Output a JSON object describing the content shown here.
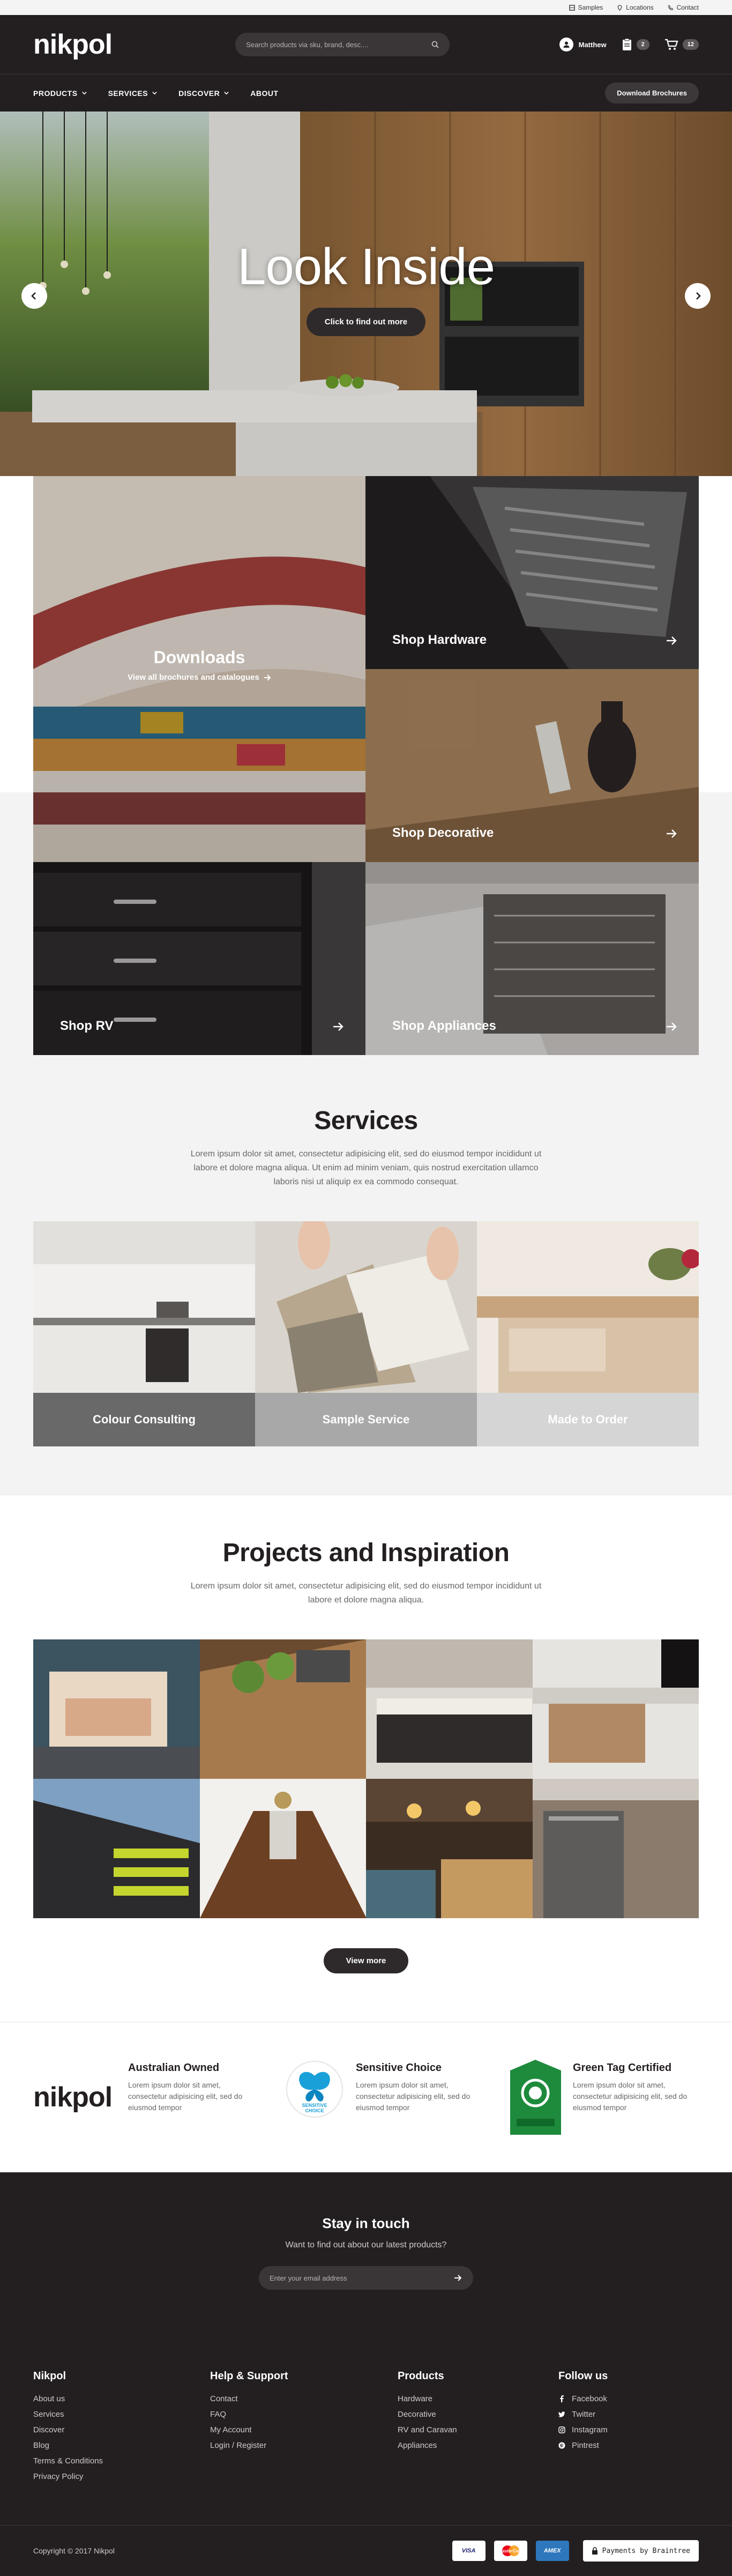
{
  "util_bar": {
    "samples": "Samples",
    "locations": "Locations",
    "contact": "Contact"
  },
  "header": {
    "logo": "nikpol",
    "search_placeholder": "Search products via sku, brand, desc....",
    "user_name": "Matthew",
    "list_count": "2",
    "cart_count": "12"
  },
  "nav": {
    "items": [
      "PRODUCTS",
      "SERVICES",
      "DISCOVER",
      "ABOUT"
    ],
    "download_button": "Download Brochures"
  },
  "hero": {
    "title": "Look Inside",
    "cta": "Click to find out more"
  },
  "categories": {
    "downloads_title": "Downloads",
    "downloads_sub": "View all brochures and catalogues",
    "tiles": [
      "Shop Hardware",
      "Shop Decorative",
      "Shop RV",
      "Shop Appliances"
    ]
  },
  "services": {
    "title": "Services",
    "desc": "Lorem ipsum dolor sit amet, consectetur adipisicing elit, sed do eiusmod tempor incididunt ut labore et dolore magna aliqua. Ut enim ad minim veniam, quis nostrud exercitation ullamco laboris nisi ut aliquip ex ea commodo consequat.",
    "cards": [
      "Colour Consulting",
      "Sample Service",
      "Made to Order"
    ],
    "colors": [
      "#6a6969",
      "#a9a8a8",
      "#d6d5d5"
    ]
  },
  "projects": {
    "title": "Projects and Inspiration",
    "desc": "Lorem ipsum dolor sit amet, consectetur adipisicing elit, sed do eiusmod tempor incididunt ut labore et dolore magna aliqua.",
    "view_more": "View more"
  },
  "trust": {
    "logo": "nikpol",
    "items": [
      {
        "title": "Australian Owned",
        "desc": "Lorem ipsum dolor sit amet, consectetur adipisicing elit, sed do eiusmod tempor"
      },
      {
        "title": "Sensitive Choice",
        "desc": "Lorem ipsum dolor sit amet, consectetur adipisicing elit, sed do eiusmod tempor"
      },
      {
        "title": "Green Tag Certified",
        "desc": "Lorem ipsum dolor sit amet, consectetur adipisicing elit, sed do eiusmod tempor"
      }
    ],
    "sensitive_label_1": "SENSITIVE",
    "sensitive_label_2": "CHOICE"
  },
  "newsletter": {
    "title": "Stay in touch",
    "subtitle": "Want to find out about our latest products?",
    "placeholder": "Enter your email address"
  },
  "footer": {
    "col1": {
      "heading": "Nikpol",
      "links": [
        "About us",
        "Services",
        "Discover",
        "Blog",
        "Terms & Conditions",
        "Privacy Policy"
      ]
    },
    "col2": {
      "heading": "Help & Support",
      "links": [
        "Contact",
        "FAQ",
        "My Account",
        "Login / Register"
      ]
    },
    "col3": {
      "heading": "Products",
      "links": [
        "Hardware",
        "Decorative",
        "RV and Caravan",
        "Appliances"
      ]
    },
    "col4": {
      "heading": "Follow us",
      "links": [
        "Facebook",
        "Twitter",
        "Instagram",
        "Pintrest"
      ]
    },
    "copyright": "Copyright © 2017 Nikpol",
    "cards": [
      "VISA",
      "MasterCard",
      "AMEX"
    ],
    "braintree": "Payments by Braintree"
  }
}
